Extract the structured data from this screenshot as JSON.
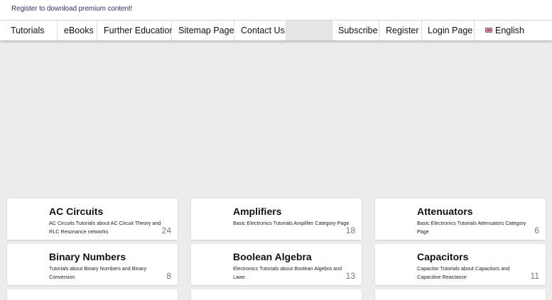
{
  "topbar": {
    "register_link": "Register to download premium content!"
  },
  "nav": {
    "tutorials": "Tutorials",
    "ebooks": "eBooks",
    "further_education": "Further Education",
    "sitemap": "Sitemap Page",
    "contact": "Contact Us",
    "subscribe": "Subscribe",
    "register": "Register",
    "login": "Login Page",
    "language": "English",
    "language_flag": "uk-flag-icon"
  },
  "categories": [
    {
      "title": "AC Circuits",
      "description": "AC Circuits Tutorials about AC Circuit Theory and RLC Resonance networks",
      "count": "24"
    },
    {
      "title": "Amplifiers",
      "description": "Basic Electronics Tutorials Amplifier Category Page",
      "count": "18"
    },
    {
      "title": "Attenuators",
      "description": "Basic Electronics Tutorials Attenuators Category Page",
      "count": "6"
    },
    {
      "title": "Binary Numbers",
      "description": "Tutorials about Binary Numbers and Binary Conversion",
      "count": "8"
    },
    {
      "title": "Boolean Algebra",
      "description": "Electronics Tutorials about Boolean Algebra and Laws",
      "count": "13"
    },
    {
      "title": "Capacitors",
      "description": "Capacitor Tutorials about Capacitors and Capacitive Reactance",
      "count": "11"
    }
  ],
  "colors": {
    "page_bg": "#ececec",
    "link": "#3a2a7a",
    "count": "#777777"
  }
}
